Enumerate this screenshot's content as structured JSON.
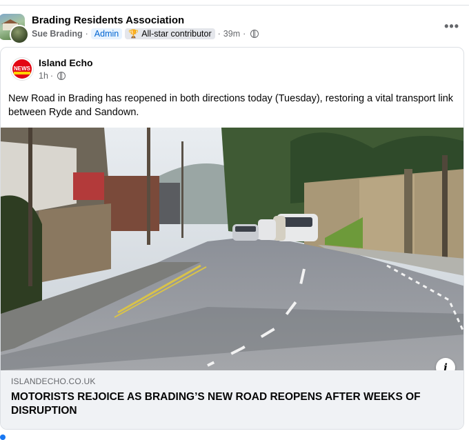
{
  "post": {
    "group_name": "Brading Residents Association",
    "author": "Sue Brading",
    "admin_badge": "Admin",
    "contributor_badge": "All-star contributor",
    "time": "39m",
    "separator": "·"
  },
  "shared": {
    "source_name": "Island Echo",
    "source_time": "1h",
    "text": "New Road in Brading has reopened in both directions today (Tuesday), restoring a vital transport link between Ryde and Sandown.",
    "logo_text": "NEWS",
    "link_domain": "ISLANDECHO.CO.UK",
    "link_headline": "MOTORISTS REJOICE AS BRADING’S NEW ROAD REOPENS AFTER WEEKS OF DISRUPTION"
  },
  "icons": {
    "more": "more-options-icon",
    "globe": "globe-icon",
    "trophy": "trophy-icon",
    "info": "info-icon"
  }
}
